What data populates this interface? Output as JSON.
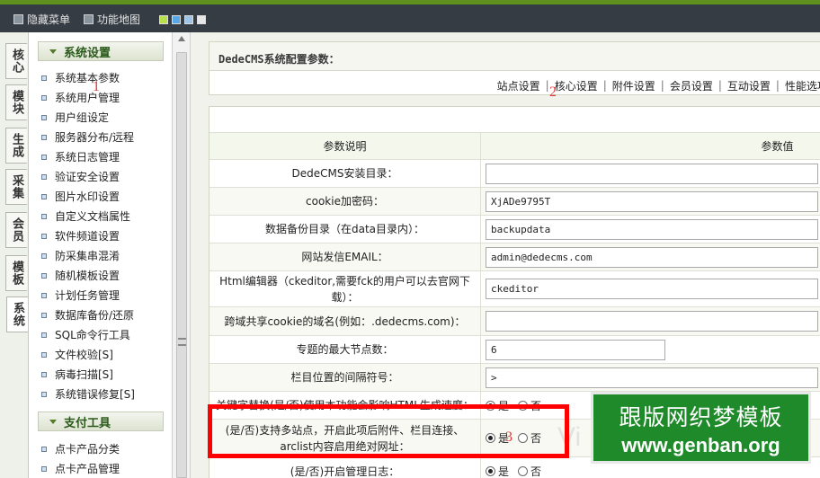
{
  "toolbar": {
    "hide_menu": "隐藏菜单",
    "site_map": "功能地图"
  },
  "theme_swatches": [
    "#b8e04a",
    "#5aa7e6",
    "#9ec5e8",
    "#e6e6e6"
  ],
  "left_tabs": [
    "核心",
    "模块",
    "生成",
    "采集",
    "会员",
    "模板",
    "系统"
  ],
  "sidebar": {
    "section1": "系统设置",
    "items1": [
      "系统基本参数",
      "系统用户管理",
      "用户组设定",
      "服务器分布/远程",
      "系统日志管理",
      "验证安全设置",
      "图片水印设置",
      "自定义文档属性",
      "软件频道设置",
      "防采集串混淆",
      "随机模板设置",
      "计划任务管理",
      "数据库备份/还原",
      "SQL命令行工具",
      "文件校验[S]",
      "病毒扫描[S]",
      "系统错误修复[S]"
    ],
    "section2": "支付工具",
    "items2": [
      "点卡产品分类",
      "点卡产品管理"
    ]
  },
  "annotations": {
    "a1": "1",
    "a2": "2",
    "a3": "3"
  },
  "config": {
    "title": "DedeCMS系统配置参数：",
    "tabs": [
      "站点设置",
      "核心设置",
      "附件设置",
      "会员设置",
      "互动设置",
      "性能选项"
    ],
    "col_desc": "参数说明",
    "col_value": "参数值",
    "rows": [
      {
        "label": "DedeCMS安装目录：",
        "value": ""
      },
      {
        "label": "cookie加密码：",
        "value": "XjADe9795T"
      },
      {
        "label": "数据备份目录（在data目录内）：",
        "value": "backupdata"
      },
      {
        "label": "网站发信EMAIL：",
        "value": "admin@dedecms.com"
      },
      {
        "label": "Html编辑器（ckeditor,需要fck的用户可以去官网下载）：",
        "value": "ckeditor"
      },
      {
        "label": "跨域共享cookie的域名(例如：.dedecms.com)：",
        "value": ""
      },
      {
        "label": "专题的最大节点数：",
        "value": "6"
      },
      {
        "label": "栏目位置的间隔符号：",
        "value": ">"
      },
      {
        "label": "关键字替换(是/否)使用本功能会影响HTML生成速度：",
        "yes": "是",
        "no": "否"
      },
      {
        "label": "(是/否)支持多站点，开启此项后附件、栏目连接、arclist内容启用绝对网址：",
        "yes": "是",
        "no": "否"
      },
      {
        "label": "(是/否)开启管理日志：",
        "yes": "是",
        "no": "否"
      }
    ]
  },
  "watermark": {
    "line1": "跟版网织梦模板",
    "line2": "www.genban.org",
    "ghost": "Vi"
  }
}
